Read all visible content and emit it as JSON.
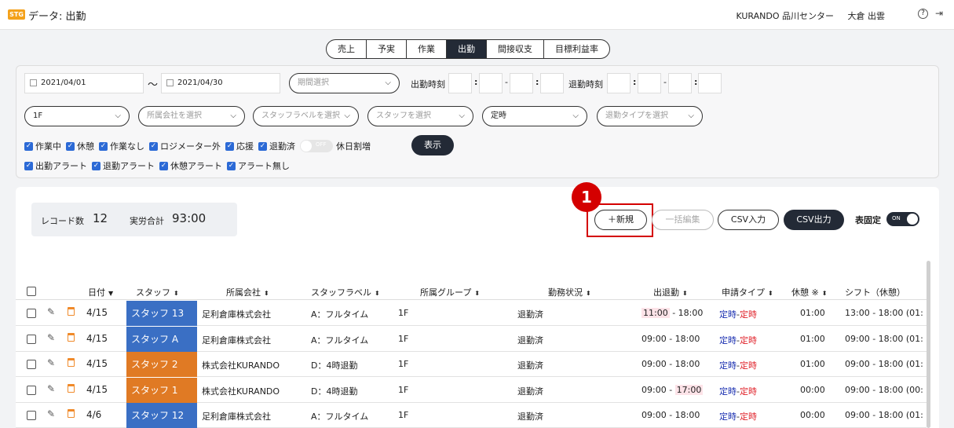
{
  "header": {
    "logo": "STG",
    "title": "データ: 出勤",
    "org": "KURANDO  品川センター",
    "user": "大倉 出雲",
    "help_icon": "help-circle-icon",
    "logout_icon": "logout-icon"
  },
  "tabs": [
    {
      "label": "売上",
      "active": false
    },
    {
      "label": "予実",
      "active": false
    },
    {
      "label": "作業",
      "active": false
    },
    {
      "label": "出勤",
      "active": true
    },
    {
      "label": "間接収支",
      "active": false
    },
    {
      "label": "目標利益率",
      "active": false
    }
  ],
  "filters": {
    "date_from": "2021/04/01",
    "tilde": "〜",
    "date_to": "2021/04/30",
    "period_placeholder": "期間選択",
    "clock_in_label": "出勤時刻",
    "clock_out_label": "退勤時刻",
    "floor": "1F",
    "company_placeholder": "所属会社を選択",
    "staff_label_placeholder": "スタッフラベルを選択",
    "staff_placeholder": "スタッフを選択",
    "schedule": "定時",
    "leave_type_placeholder": "退勤タイプを選択",
    "checks_row1": [
      "作業中",
      "休憩",
      "作業なし",
      "ロジメーター外",
      "応援",
      "退勤済"
    ],
    "toggle_off": "OFF",
    "holiday_label": "休日割増",
    "show_button": "表示",
    "checks_row2": [
      "出勤アラート",
      "退勤アラート",
      "休憩アラート",
      "アラート無し"
    ]
  },
  "summary": {
    "record_label": "レコード数",
    "record_count": "12",
    "total_label": "実労合計",
    "total_value": "93:00"
  },
  "actions": {
    "new": "＋新規",
    "bulk_edit": "一括編集",
    "csv_in": "CSV入力",
    "csv_out": "CSV出力",
    "fix_header": "表固定",
    "toggle_on": "ON",
    "callout": "1"
  },
  "table": {
    "headers": [
      "日付",
      "スタッフ",
      "所属会社",
      "スタッフラベル",
      "所属グループ",
      "勤務状況",
      "出退勤",
      "申請タイプ",
      "休憩 ※",
      "シフト（休憩）"
    ],
    "rows": [
      {
        "date": "4/15",
        "staff": "スタッフ 13",
        "color": "#3a6fc4",
        "company": "足利倉庫株式会社",
        "label": "A：フルタイム",
        "group": "1F",
        "status": "退勤済",
        "in": "11:00",
        "dash": " - ",
        "out": "18:00",
        "late_in": true,
        "late_out": false,
        "req_a": "定時",
        "req_sep": "-",
        "req_b": "定時",
        "break": "01:00",
        "shift": "13:00 - 18:00 (01:"
      },
      {
        "date": "4/15",
        "staff": "スタッフ A",
        "color": "#3a6fc4",
        "company": "足利倉庫株式会社",
        "label": "A：フルタイム",
        "group": "1F",
        "status": "退勤済",
        "in": "09:00",
        "dash": " - ",
        "out": "18:00",
        "late_in": false,
        "late_out": false,
        "req_a": "定時",
        "req_sep": "-",
        "req_b": "定時",
        "break": "01:00",
        "shift": "09:00 - 18:00 (01:"
      },
      {
        "date": "4/15",
        "staff": "スタッフ 2",
        "color": "#e07a24",
        "company": "株式会社KURANDO",
        "label": "D：4時退勤",
        "group": "1F",
        "status": "退勤済",
        "in": "09:00",
        "dash": " - ",
        "out": "18:00",
        "late_in": false,
        "late_out": false,
        "req_a": "定時",
        "req_sep": "-",
        "req_b": "定時",
        "break": "01:00",
        "shift": "09:00 - 18:00 (01:"
      },
      {
        "date": "4/15",
        "staff": "スタッフ 1",
        "color": "#e07a24",
        "company": "株式会社KURANDO",
        "label": "D：4時退勤",
        "group": "1F",
        "status": "退勤済",
        "in": "09:00",
        "dash": " - ",
        "out": "17:00",
        "late_in": false,
        "late_out": true,
        "req_a": "定時",
        "req_sep": "-",
        "req_b": "定時",
        "break": "00:00",
        "shift": "09:00 - 18:00 (00:"
      },
      {
        "date": "4/6",
        "staff": "スタッフ 12",
        "color": "#3a6fc4",
        "company": "足利倉庫株式会社",
        "label": "A：フルタイム",
        "group": "1F",
        "status": "退勤済",
        "in": "09:00",
        "dash": " - ",
        "out": "18:00",
        "late_in": false,
        "late_out": false,
        "req_a": "定時",
        "req_sep": "-",
        "req_b": "定時",
        "break": "00:00",
        "shift": "09:00 - 18:00 (01:"
      }
    ]
  }
}
